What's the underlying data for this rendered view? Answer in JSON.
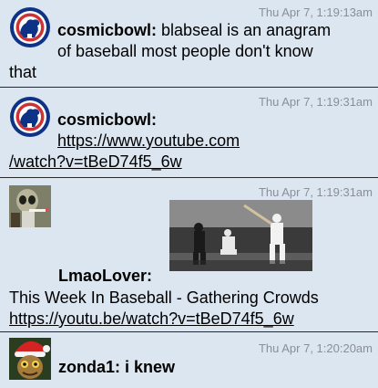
{
  "messages": [
    {
      "timestamp": "Thu Apr 7, 1:19:13am",
      "username": "cosmicbowl:",
      "text_line1": " blabseal is an anagram",
      "text_line2": "of baseball most people don't know",
      "text_line3": "that",
      "avatar_icon": "cubs-bear-logo"
    },
    {
      "timestamp": "Thu Apr 7, 1:19:31am",
      "username": "cosmicbowl:",
      "link_line1": "https://www.youtube.com",
      "link_line2": "/watch?v=tBeD74f5_6w",
      "avatar_icon": "cubs-bear-logo"
    },
    {
      "timestamp": "Thu Apr 7, 1:19:31am",
      "username": "LmaoLover:",
      "text": "This Week In Baseball - Gathering Crowds",
      "link": "https://youtu.be/watch?v=tBeD74f5_6w",
      "thumbnail_icon": "baseball-video-thumbnail",
      "avatar_icon": "alien-smoking-avatar"
    },
    {
      "timestamp": "Thu Apr 7, 1:20:20am",
      "username": "zonda1:",
      "text": " i knew",
      "avatar_icon": "santa-hat-avatar"
    }
  ],
  "colors": {
    "background": "#dbe6f1",
    "timestamp": "#8a8f96",
    "divider": "#2a2a2a",
    "cubs_blue": "#0e3386",
    "cubs_red": "#cc3433"
  }
}
